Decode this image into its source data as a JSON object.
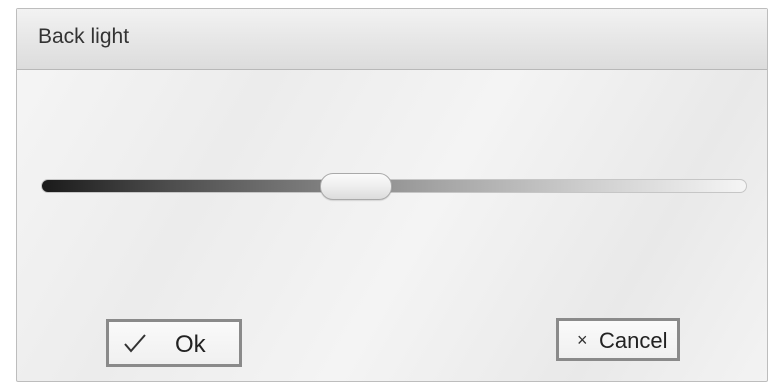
{
  "dialog": {
    "title": "Back light"
  },
  "slider": {
    "level_percent": 44
  },
  "buttons": {
    "ok_icon": "check-icon",
    "ok_label": "Ok",
    "cancel_icon": "×",
    "cancel_label": "Cancel"
  }
}
